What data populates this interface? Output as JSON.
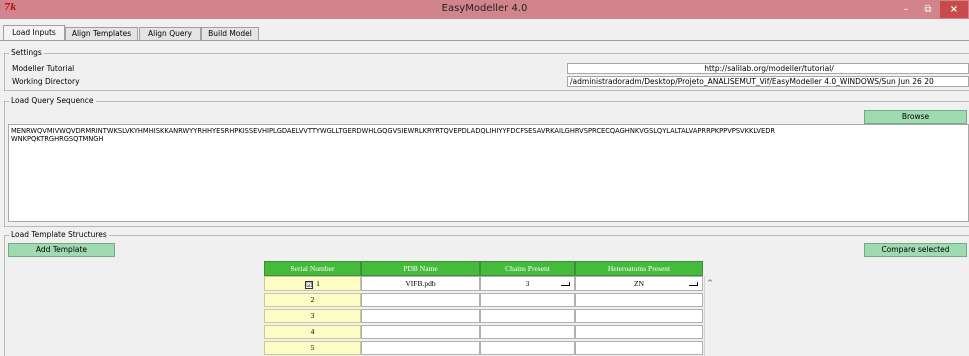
{
  "window": {
    "logo": "7k",
    "title": "EasyModeller 4.0",
    "minimize": "–",
    "maximize": "⧉",
    "close": "×"
  },
  "tabs": [
    "Load Inputs",
    "Align Templates",
    "Align Query",
    "Build Model"
  ],
  "settings": {
    "title": "Settings",
    "tutorial_label": "Modeller Tutorial",
    "tutorial_value": "http://salilab.org/modeller/tutorial/",
    "workdir_label": "Working Directory",
    "workdir_value": "/administradoradm/Desktop/Projeto_ANALISEMUT_Vif/EasyModeller 4.0_WINDOWS/Sun Jun 26 20"
  },
  "query": {
    "title": "Load Query Sequence",
    "browse_label": "Browse",
    "sequence_line1": "MENRWQVMIVWQVDRMRINTWKSLVKYHMHISKKANRWYYRHHYESRHPKISSEVHIPLGDAELVVTTYWGLLTGERDWHLGQGVSIEWRLKRYRTQVEPDLADQLIHIYYFDCFSESAVRKAILGHRVSPRCECQAGHNKVGSLQYLALTALVAPRRPKPPVPSVKKLVEDR",
    "sequence_line2": "WNKPQKTRGHRGSQTMNGH"
  },
  "templates": {
    "title": "Load Template Structures",
    "add_label": "Add Template",
    "compare_label": "Compare selected",
    "columns": [
      "Serial Number",
      "PDB Name",
      "Chains Present",
      "Heteroatoms Present"
    ],
    "rows": [
      {
        "serial": "1",
        "checked": "☑",
        "pdb": "VIFB.pdb",
        "chains": "3",
        "hetero": "ZN"
      },
      {
        "serial": "2",
        "checked": "",
        "pdb": "",
        "chains": "",
        "hetero": ""
      },
      {
        "serial": "3",
        "checked": "",
        "pdb": "",
        "chains": "",
        "hetero": ""
      },
      {
        "serial": "4",
        "checked": "",
        "pdb": "",
        "chains": "",
        "hetero": ""
      },
      {
        "serial": "5",
        "checked": "",
        "pdb": "",
        "chains": "",
        "hetero": ""
      }
    ],
    "scroll_up": "^"
  },
  "colors": {
    "titlebar": "#d2848c",
    "button_green": "#9fdab0",
    "header_green": "#45bb3c",
    "serial_yellow": "#fcfcc4"
  }
}
